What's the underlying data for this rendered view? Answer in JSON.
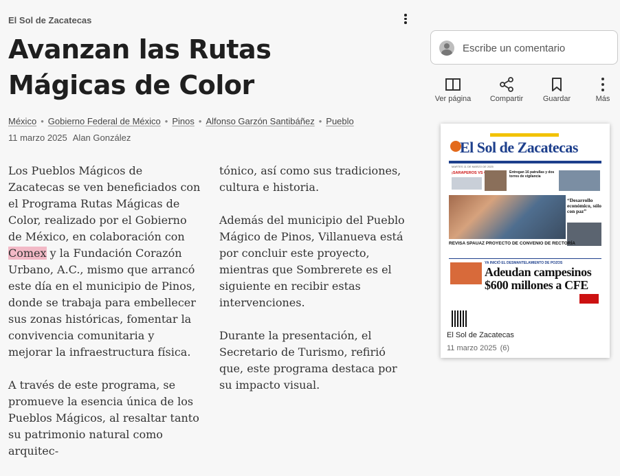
{
  "article": {
    "source": "El Sol de Zacatecas",
    "title": "Avanzan las Rutas Mágicas de Color",
    "tags": [
      "México",
      "Gobierno Federal de México",
      "Pinos",
      "Alfonso Garzón Santibáñez",
      "Pueblo"
    ],
    "date": "11 marzo 2025",
    "author": "Alan González",
    "col1": {
      "p1_before": "Los Pueblos Mágicos de Zacatecas se ven beneficiados con el Programa Rutas Mágicas de Color, realizado por el Gobierno de México, en colaboración con ",
      "p1_highlight": "Comex",
      "p1_after": " y la Fundación Corazón Urbano, A.C., mismo que arrancó este día en el municipio de Pinos, donde se trabaja para embellecer sus zonas históricas, fomentar la convivencia comunitaria y mejorar la infraestructura física.",
      "p2": "A través de este programa, se promueve la esencia única de los Pueblos Mágicos, al resaltar tanto su patrimonio natural como arquitec-"
    },
    "col2": {
      "p1": "tónico, así como sus tradiciones, cultura e historia.",
      "p2": "Además del municipio del Pueblo Mágico de Pinos, Villanueva está por concluir este proyecto, mientras que Sombrerete es el siguiente en recibir estas intervenciones.",
      "p3": "Durante la presentación, el Secretario de Turismo, refirió que, este programa destaca por su impacto visual."
    }
  },
  "comment": {
    "placeholder": "Escribe un comentario",
    "icon": "avatar-icon"
  },
  "toolbar": {
    "view_page": "Ver página",
    "share": "Compartir",
    "save": "Guardar",
    "more": "Más"
  },
  "thumbnail": {
    "masthead": "El Sol de Zacatecas",
    "date_line": "MARTES 11 DE MARZO DE 2025",
    "left_headline": "¡SARAPEROS VS CHARROS!",
    "top_right_headline": "Entregan 16 patrullas y dos torres de vigilancia",
    "quote_headline": "“Desarrollo económico, sólo con paz”",
    "photo_caption": "REVISA SPAUAZ PROYECTO DE CONVENIO DE RECTORÍA",
    "kicker": "YA INICIÓ EL DESMANTELAMIENTO DE POZOS",
    "main_headline": "Adeudan campesinos $600 millones a CFE",
    "caption_title": "El Sol de Zacatecas",
    "caption_date": "11 marzo 2025",
    "caption_count": "(6)"
  }
}
